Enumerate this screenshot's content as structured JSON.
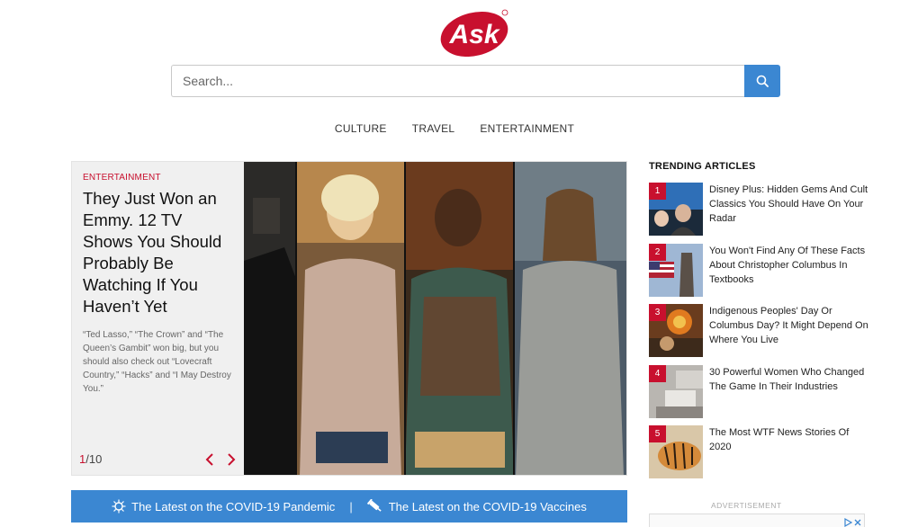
{
  "logo": {
    "text": "Ask",
    "color": "#c8102e"
  },
  "search": {
    "placeholder": "Search...",
    "value": ""
  },
  "nav": {
    "items": [
      "CULTURE",
      "TRAVEL",
      "ENTERTAINMENT"
    ]
  },
  "hero": {
    "category": "ENTERTAINMENT",
    "title": "They Just Won an Emmy. 12 TV Shows You Should Probably Be Watching If You Haven’t Yet",
    "description": "“Ted Lasso,” “The Crown” and “The Queen’s Gambit” won big, but you should also check out “Lovecraft Country,” “Hacks” and “I May Destroy You.”",
    "counter_current": "1",
    "counter_total": "/10"
  },
  "covid": {
    "pandemic_label": "The Latest on the COVID-19 Pandemic",
    "separator": "|",
    "vaccines_label": "The Latest on the COVID-19 Vaccines"
  },
  "trending": {
    "heading": "TRENDING ARTICLES",
    "items": [
      {
        "number": "1",
        "title": "Disney Plus: Hidden Gems And Cult Classics You Should Have On Your Radar"
      },
      {
        "number": "2",
        "title": "You Won't Find Any Of These Facts About Christopher Columbus In Textbooks"
      },
      {
        "number": "3",
        "title": "Indigenous Peoples' Day Or Columbus Day? It Might Depend On Where You Live"
      },
      {
        "number": "4",
        "title": "30 Powerful Women Who Changed The Game In Their Industries"
      },
      {
        "number": "5",
        "title": "The Most WTF News Stories Of 2020"
      }
    ]
  },
  "ad": {
    "label": "ADVERTISEMENT"
  },
  "colors": {
    "brand_red": "#c8102e",
    "accent_blue": "#3b87d2"
  }
}
